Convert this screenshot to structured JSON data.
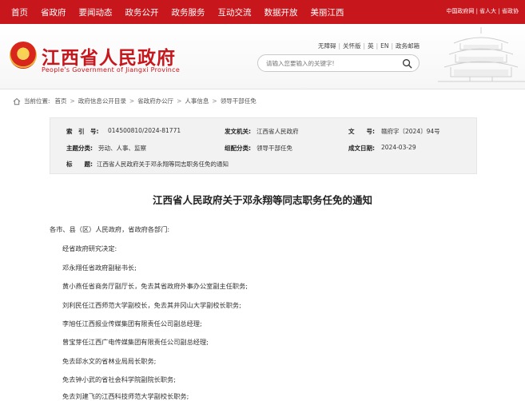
{
  "topnav": {
    "items": [
      "首页",
      "省政府",
      "要闻动态",
      "政务公开",
      "政务服务",
      "互动交流",
      "数据开放",
      "美丽江西"
    ],
    "right_text": "中国政府网 | 省人大 | 省政协"
  },
  "header": {
    "title": "江西省人民政府",
    "subtitle": "People's Government of Jiangxi Province",
    "access_links": [
      "无障碍",
      "关怀版",
      "英",
      "EN",
      "政务邮箱"
    ],
    "search_placeholder": "请输入您要输入的关键字!"
  },
  "breadcrumb": {
    "label": "当前位置:",
    "items": [
      "首页",
      "政府信息公开目录",
      "省政府办公厅",
      "人事信息",
      "领导干部任免"
    ]
  },
  "meta": {
    "index_label": "索　引　号:",
    "index_value": "014500810/2024-81771",
    "issuer_label": "发文机关:",
    "issuer_value": "江西省人民政府",
    "docno_label": "文　　号:",
    "docno_value": "赣府字〔2024〕94号",
    "category_label": "主题分类:",
    "category_value": "劳动、人事、监察",
    "form_label": "组配分类:",
    "form_value": "领导干部任免",
    "date_label": "成文日期:",
    "date_value": "2024-03-29",
    "title_label": "标　　题:",
    "title_value": "江西省人民政府关于邓永翔等同志职务任免的通知"
  },
  "document": {
    "title": "江西省人民政府关于邓永翔等同志职务任免的通知",
    "salutation": "各市、县（区）人民政府，省政府各部门:",
    "paragraphs": [
      "经省政府研究决定:",
      "邓永翔任省政府副秘书长;",
      "黄小燕任省商务厅副厅长，免去其省政府外事办公室副主任职务;",
      "刘利民任江西师范大学副校长，免去其井冈山大学副校长职务;",
      "李旭任江西报业传媒集团有限责任公司副总经理;",
      "曾宝芽任江西广电传媒集团有限责任公司副总经理;",
      "免去邱水文的省林业局局长职务;",
      "免去钟小武的省社会科学院副院长职务;",
      "免去刘建飞的江西科技师范大学副校长职务;"
    ]
  }
}
